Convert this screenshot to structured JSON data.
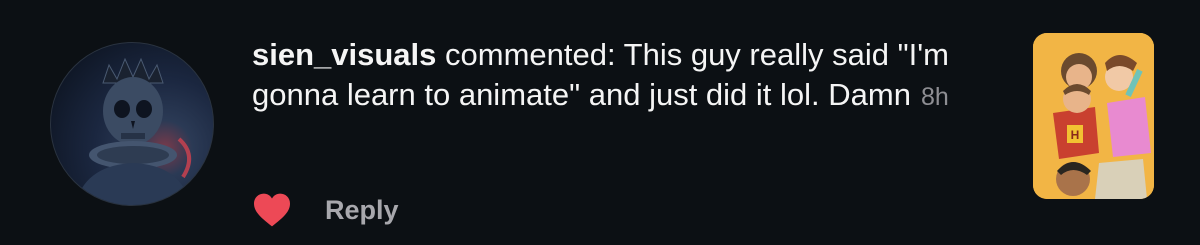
{
  "comment": {
    "username": "sien_visuals",
    "text": " commented: This guy really said \"I'm gonna learn to animate\" and just did it lol. Damn",
    "time": "8h"
  },
  "actions": {
    "reply_label": "Reply",
    "liked": true
  },
  "colors": {
    "background": "#0c1014",
    "heart": "#ed4956",
    "muted": "#8e8e93",
    "reply": "#a8a8ad"
  },
  "icons": {
    "like": "heart-icon"
  }
}
